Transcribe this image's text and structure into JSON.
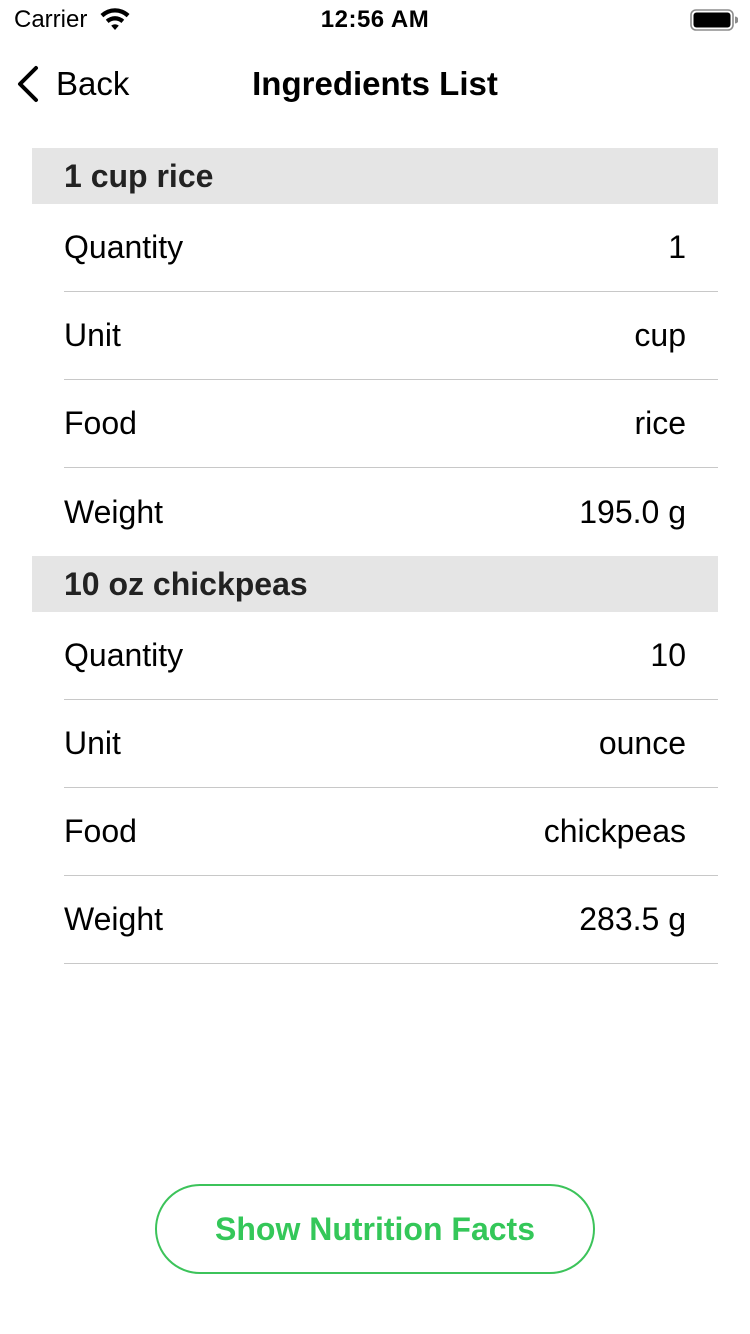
{
  "status_bar": {
    "carrier": "Carrier",
    "time": "12:56 AM"
  },
  "nav": {
    "back_label": "Back",
    "title": "Ingredients List"
  },
  "sections": [
    {
      "header": "1 cup rice",
      "rows": [
        {
          "label": "Quantity",
          "value": "1"
        },
        {
          "label": "Unit",
          "value": "cup"
        },
        {
          "label": "Food",
          "value": "rice"
        },
        {
          "label": "Weight",
          "value": "195.0 g"
        }
      ]
    },
    {
      "header": "10 oz chickpeas",
      "rows": [
        {
          "label": "Quantity",
          "value": "10"
        },
        {
          "label": "Unit",
          "value": "ounce"
        },
        {
          "label": "Food",
          "value": "chickpeas"
        },
        {
          "label": "Weight",
          "value": "283.5 g"
        }
      ]
    }
  ],
  "footer": {
    "button_label": "Show Nutrition Facts"
  },
  "colors": {
    "accent": "#34c759",
    "section_header_bg": "#e5e5e5",
    "separator": "#c8c8c8"
  },
  "icons": {
    "wifi": "wifi-icon",
    "battery": "battery-icon",
    "back": "chevron-left-icon"
  }
}
